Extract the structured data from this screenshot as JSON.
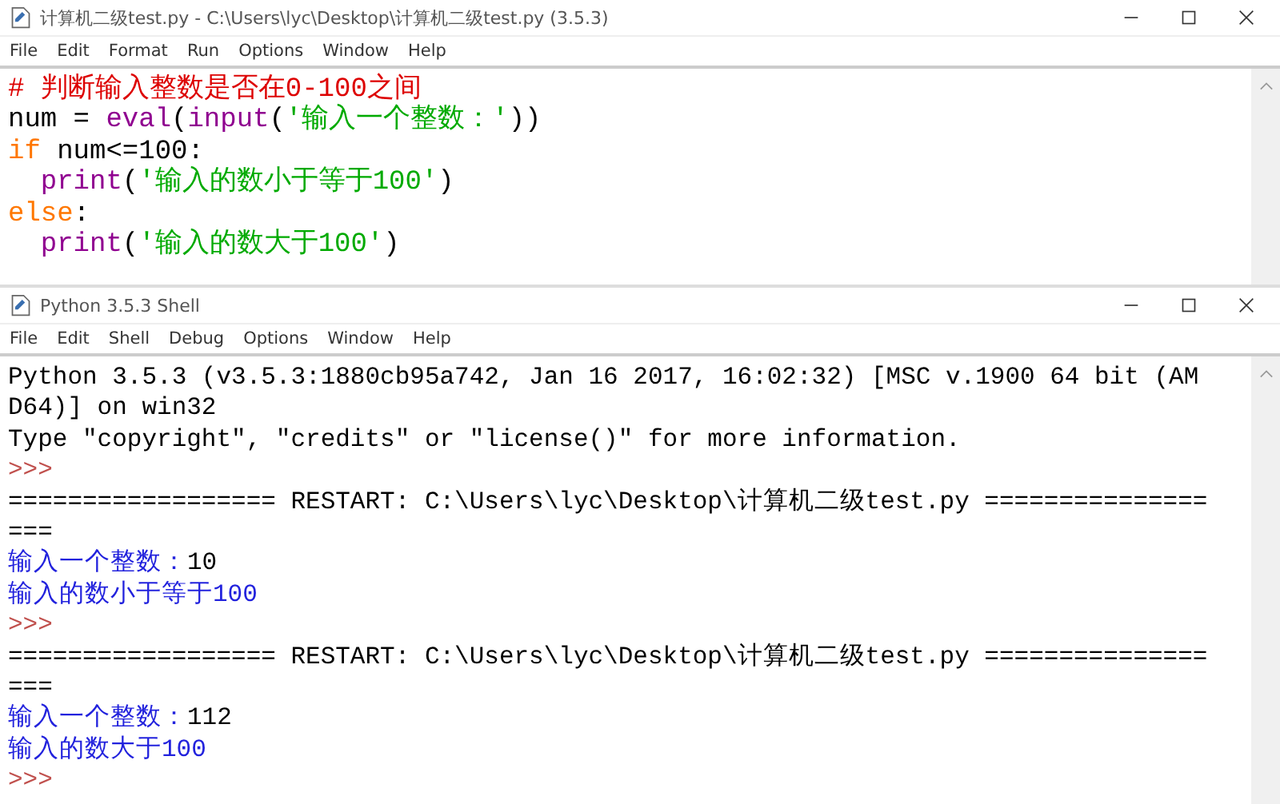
{
  "editor": {
    "title": "计算机二级test.py - C:\\Users\\lyc\\Desktop\\计算机二级test.py (3.5.3)",
    "menu": [
      "File",
      "Edit",
      "Format",
      "Run",
      "Options",
      "Window",
      "Help"
    ],
    "lines": [
      [
        {
          "kind": "comment",
          "text": "# 判断输入整数是否在0-100之间"
        }
      ],
      [
        {
          "kind": "plain",
          "text": "num = "
        },
        {
          "kind": "builtin",
          "text": "eval"
        },
        {
          "kind": "plain",
          "text": "("
        },
        {
          "kind": "builtin",
          "text": "input"
        },
        {
          "kind": "plain",
          "text": "("
        },
        {
          "kind": "string",
          "text": "'输入一个整数：'"
        },
        {
          "kind": "plain",
          "text": "))"
        }
      ],
      [
        {
          "kind": "keyword",
          "text": "if"
        },
        {
          "kind": "plain",
          "text": " num<=100:"
        }
      ],
      [
        {
          "kind": "builtin",
          "text": "  print"
        },
        {
          "kind": "plain",
          "text": "("
        },
        {
          "kind": "string",
          "text": "'输入的数小于等于100'"
        },
        {
          "kind": "plain",
          "text": ")"
        }
      ],
      [
        {
          "kind": "keyword",
          "text": "else"
        },
        {
          "kind": "plain",
          "text": ":"
        }
      ],
      [
        {
          "kind": "builtin",
          "text": "  print"
        },
        {
          "kind": "plain",
          "text": "("
        },
        {
          "kind": "string",
          "text": "'输入的数大于100'"
        },
        {
          "kind": "plain",
          "text": ")"
        }
      ]
    ]
  },
  "shell": {
    "title": "Python 3.5.3 Shell",
    "menu": [
      "File",
      "Edit",
      "Shell",
      "Debug",
      "Options",
      "Window",
      "Help"
    ],
    "lines": [
      [
        {
          "kind": "plain",
          "text": "Python 3.5.3 (v3.5.3:1880cb95a742, Jan 16 2017, 16:02:32) [MSC v.1900 64 bit (AM"
        }
      ],
      [
        {
          "kind": "plain",
          "text": "D64)] on win32"
        }
      ],
      [
        {
          "kind": "plain",
          "text": "Type \"copyright\", \"credits\" or \"license()\" for more information."
        }
      ],
      [
        {
          "kind": "prompt",
          "text": ">>>"
        }
      ],
      [
        {
          "kind": "plain",
          "text": "================== RESTART: C:\\Users\\lyc\\Desktop\\计算机二级test.py ==============="
        }
      ],
      [
        {
          "kind": "plain",
          "text": "==="
        }
      ],
      [
        {
          "kind": "stdout",
          "text": "输入一个整数："
        },
        {
          "kind": "plain",
          "text": "10"
        }
      ],
      [
        {
          "kind": "stdout",
          "text": "输入的数小于等于100"
        }
      ],
      [
        {
          "kind": "prompt",
          "text": ">>>"
        }
      ],
      [
        {
          "kind": "plain",
          "text": "================== RESTART: C:\\Users\\lyc\\Desktop\\计算机二级test.py ==============="
        }
      ],
      [
        {
          "kind": "plain",
          "text": "==="
        }
      ],
      [
        {
          "kind": "stdout",
          "text": "输入一个整数："
        },
        {
          "kind": "plain",
          "text": "112"
        }
      ],
      [
        {
          "kind": "stdout",
          "text": "输入的数大于100"
        }
      ],
      [
        {
          "kind": "prompt",
          "text": ">>>"
        }
      ]
    ]
  }
}
